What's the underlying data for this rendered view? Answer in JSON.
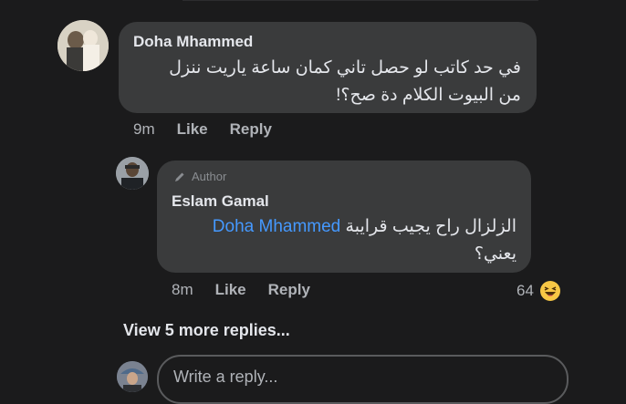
{
  "comments": [
    {
      "author": "Doha Mhammed",
      "text_line1": "في حد كاتب لو حصل تاني كمان ساعة ياريت ننزل",
      "text_line2": "من البيوت الكلام دة صح؟!",
      "time": "9m",
      "like_label": "Like",
      "reply_label": "Reply"
    }
  ],
  "reply": {
    "badge": "Author",
    "author": "Eslam Gamal",
    "mention": "Doha Mhammed",
    "text_line1_rest": "الزلزال راح يجيب قرايبة",
    "text_line2": "يعني؟",
    "time": "8m",
    "like_label": "Like",
    "reply_label": "Reply",
    "reaction_count": "64",
    "reaction_icon": "laughing-emoji"
  },
  "view_more": "View 5 more replies...",
  "composer": {
    "placeholder": "Write a reply..."
  },
  "colors": {
    "bubble": "#3a3b3c",
    "mention": "#4599ff",
    "background": "#1b1b1c"
  }
}
